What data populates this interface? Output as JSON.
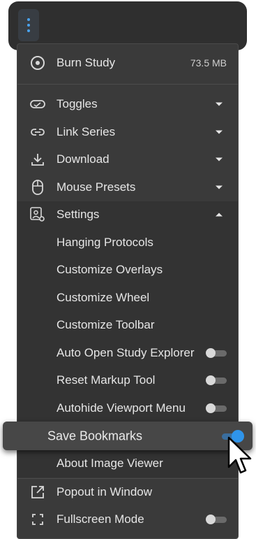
{
  "toolbar": {
    "menu_button_icon": "kebab-vertical-icon",
    "accent": "#4aa3f0"
  },
  "menu": {
    "burn": {
      "label": "Burn Study",
      "size": "73.5 MB",
      "icon": "disc-icon"
    },
    "items": [
      {
        "label": "Toggles",
        "icon": "toggle-icon"
      },
      {
        "label": "Link Series",
        "icon": "link-icon"
      },
      {
        "label": "Download",
        "icon": "download-icon"
      },
      {
        "label": "Mouse Presets",
        "icon": "mouse-icon"
      },
      {
        "label": "Settings",
        "icon": "settings-icon"
      }
    ],
    "settings": {
      "hanging_protocols": "Hanging Protocols",
      "customize_overlays": "Customize Overlays",
      "customize_wheel": "Customize Wheel",
      "customize_toolbar": "Customize Toolbar",
      "auto_open": {
        "label": "Auto Open Study Explorer",
        "on": false
      },
      "reset_markup": {
        "label": "Reset Markup Tool",
        "on": false
      },
      "autohide": {
        "label": "Autohide Viewport Menu",
        "on": false
      },
      "save_bookmarks": {
        "label": "Save Bookmarks",
        "on": true
      },
      "about": "About Image Viewer"
    },
    "popout": {
      "label": "Popout in Window",
      "icon": "popout-icon"
    },
    "fullscreen": {
      "label": "Fullscreen Mode",
      "icon": "fullscreen-icon",
      "on": false
    }
  },
  "colors": {
    "menu_bg": "#3a3a3a",
    "toggle_on": "#2f94ea"
  }
}
